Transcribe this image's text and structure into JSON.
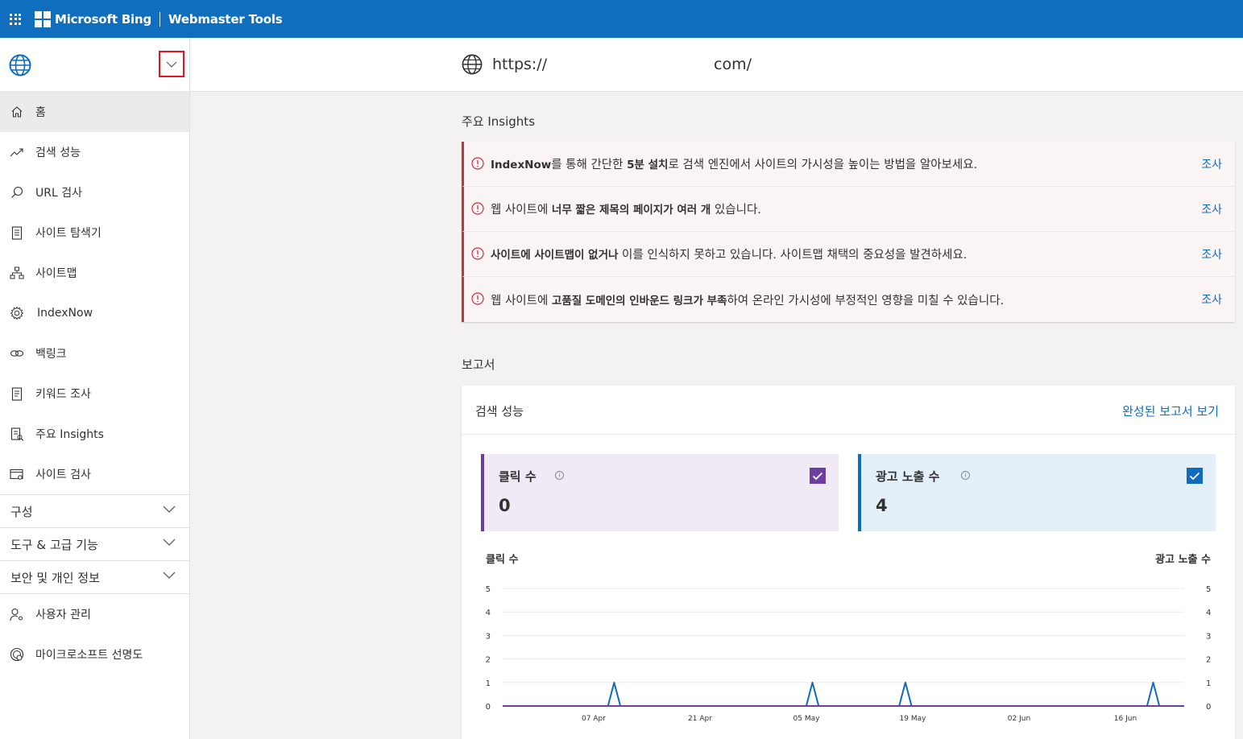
{
  "topbar": {
    "brand": "Microsoft Bing",
    "product": "Webmaster Tools"
  },
  "sidebar": {
    "items": [
      {
        "label": "홈",
        "icon": "home-icon",
        "active": true
      },
      {
        "label": "검색 성능",
        "icon": "trend-icon"
      },
      {
        "label": "URL 검사",
        "icon": "search-icon"
      },
      {
        "label": "사이트 탐색기",
        "icon": "document-icon"
      },
      {
        "label": "사이트맵",
        "icon": "sitemap-icon"
      },
      {
        "label": "IndexNow",
        "icon": "gear-icon"
      },
      {
        "label": "백링크",
        "icon": "link-icon"
      },
      {
        "label": "키워드 조사",
        "icon": "list-icon"
      },
      {
        "label": "주요 Insights",
        "icon": "insights-icon"
      },
      {
        "label": "사이트 검사",
        "icon": "scan-icon"
      }
    ],
    "groups": [
      {
        "label": "구성"
      },
      {
        "label": "도구 & 고급 기능"
      },
      {
        "label": "보안 및 개인 정보"
      }
    ],
    "bottom_items": [
      {
        "label": "사용자 관리",
        "icon": "user-settings-icon"
      },
      {
        "label": "마이크로소프트 선명도",
        "icon": "clarity-icon"
      }
    ]
  },
  "site": {
    "url_prefix": "https://",
    "url_suffix": "com/"
  },
  "insights": {
    "title": "주요 Insights",
    "items": [
      {
        "bold": "IndexNow",
        "text1": "를 통해 간단한 ",
        "bold2": "5분 설치",
        "text2": "로 검색 엔진에서 사이트의 가시성을 높이는 방법을 알아보세요.",
        "link": "조사"
      },
      {
        "pre": "웹 사이트에 ",
        "bold": "너무 짧은 제목의 페이지가 여러 개",
        "text": " 있습니다.",
        "link": "조사"
      },
      {
        "bold": "사이트에 사이트맵이 없거나",
        "text": " 이를 인식하지 못하고 있습니다. 사이트맵 채택의 중요성을 발견하세요.",
        "link": "조사"
      },
      {
        "pre": "웹 사이트에 ",
        "bold": "고품질 도메인의 인바운드 링크가 부족",
        "text": "하여 온라인 가시성에 부정적인 영향을 미칠 수 있습니다.",
        "link": "조사"
      }
    ]
  },
  "reports": {
    "title": "보고서",
    "card_title": "검색 성능",
    "card_link": "완성된 보고서 보기",
    "clicks": {
      "label": "클릭 수",
      "value": "0",
      "checked": true,
      "color": "#6b3fa0"
    },
    "impressions": {
      "label": "광고 노출 수",
      "value": "4",
      "checked": true,
      "color": "#0f6cbd"
    },
    "chart_left_label": "클릭 수",
    "chart_right_label": "광고 노출 수"
  },
  "chart_data": {
    "type": "line",
    "x_tick_labels": [
      "07 Apr",
      "21 Apr",
      "05 May",
      "19 May",
      "02 Jun",
      "16 Jun"
    ],
    "y_ticks": [
      0,
      1,
      2,
      3,
      4,
      5
    ],
    "ylim": [
      0,
      5
    ],
    "grid": true,
    "series": [
      {
        "name": "클릭 수",
        "color": "#6b3fa0",
        "axis": "left",
        "values": [
          0,
          0,
          0,
          0,
          0,
          0,
          0,
          0,
          0,
          0,
          0,
          0,
          0,
          0,
          0,
          0,
          0,
          0,
          0,
          0,
          0,
          0,
          0,
          0,
          0,
          0,
          0,
          0,
          0,
          0,
          0,
          0,
          0,
          0,
          0,
          0,
          0,
          0,
          0,
          0,
          0,
          0,
          0,
          0,
          0,
          0,
          0,
          0,
          0,
          0,
          0,
          0,
          0,
          0,
          0,
          0,
          0,
          0,
          0,
          0,
          0,
          0,
          0,
          0,
          0,
          0,
          0,
          0,
          0,
          0,
          0,
          0,
          0,
          0,
          0,
          0,
          0,
          0,
          0,
          0,
          0,
          0,
          0,
          0,
          0,
          0,
          0,
          0,
          0,
          0,
          0,
          0
        ]
      },
      {
        "name": "광고 노출 수",
        "color": "#0f6cbd",
        "axis": "right",
        "values": [
          0,
          0,
          0,
          0,
          0,
          0,
          0,
          0,
          0,
          0,
          0,
          0,
          0,
          0,
          0,
          0,
          0,
          0,
          1,
          0,
          0,
          0,
          0,
          0,
          0,
          0,
          0,
          0,
          0,
          0,
          0,
          0,
          0,
          0,
          0,
          0,
          0,
          0,
          0,
          0,
          0,
          0,
          0,
          0,
          0,
          0,
          0,
          0,
          0,
          0,
          1,
          0,
          0,
          0,
          0,
          0,
          0,
          0,
          0,
          0,
          0,
          0,
          0,
          0,
          0,
          1,
          0,
          0,
          0,
          0,
          0,
          0,
          0,
          0,
          0,
          0,
          0,
          0,
          0,
          0,
          0,
          0,
          0,
          0,
          0,
          0,
          0,
          0,
          0,
          0,
          0,
          0,
          0,
          0,
          0,
          0,
          0,
          0,
          0,
          0,
          0,
          0,
          0,
          0,
          0,
          1,
          0,
          0,
          0,
          0,
          0
        ]
      }
    ]
  }
}
